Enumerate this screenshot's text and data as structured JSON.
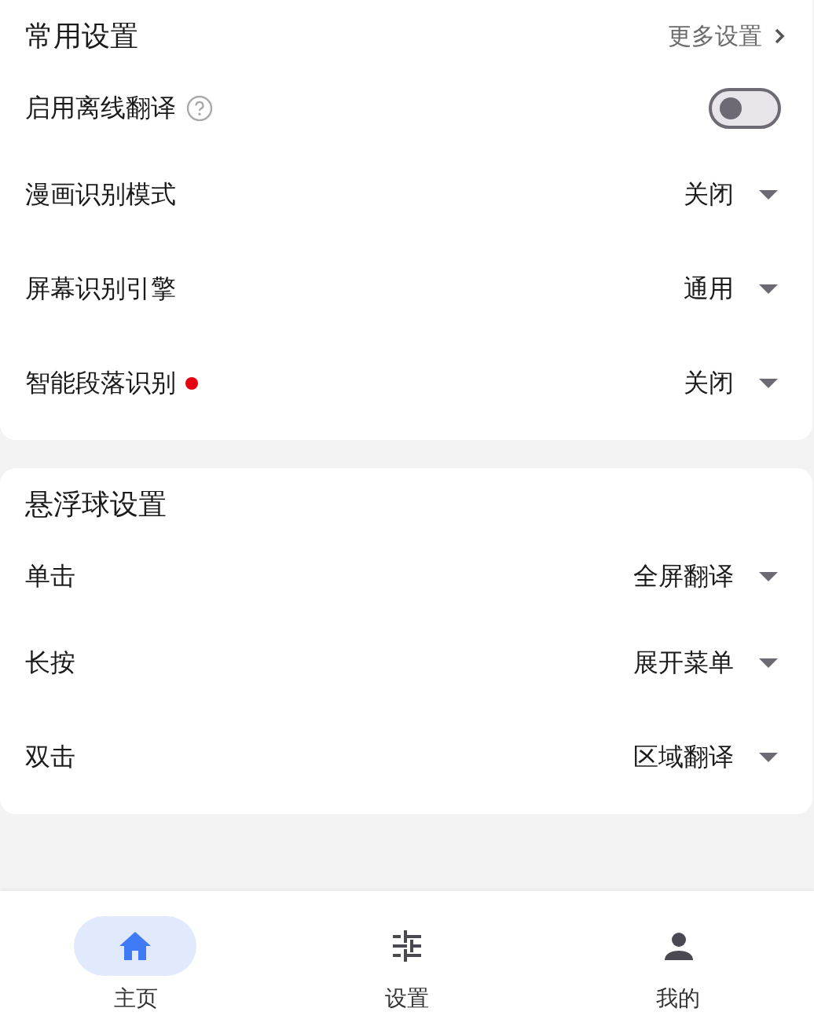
{
  "sections": [
    {
      "title": "常用设置",
      "link": "更多设置",
      "items": [
        {
          "kind": "toggle",
          "label": "启用离线翻译",
          "help": true,
          "dot": false,
          "on": false
        },
        {
          "kind": "dropdown",
          "label": "漫画识别模式",
          "help": false,
          "dot": false,
          "value": "关闭"
        },
        {
          "kind": "dropdown",
          "label": "屏幕识别引擎",
          "help": false,
          "dot": false,
          "value": "通用"
        },
        {
          "kind": "dropdown",
          "label": "智能段落识别",
          "help": false,
          "dot": true,
          "value": "关闭"
        }
      ]
    },
    {
      "title": "悬浮球设置",
      "items": [
        {
          "kind": "dropdown",
          "label": "单击",
          "help": false,
          "dot": false,
          "value": "全屏翻译"
        },
        {
          "kind": "dropdown",
          "label": "长按",
          "help": false,
          "dot": false,
          "value": "展开菜单"
        },
        {
          "kind": "dropdown",
          "label": "双击",
          "help": false,
          "dot": false,
          "value": "区域翻译"
        }
      ]
    }
  ],
  "nav": [
    {
      "kind": "home",
      "label": "主页",
      "selected": true
    },
    {
      "kind": "sliders",
      "label": "设置",
      "selected": false
    },
    {
      "kind": "person",
      "label": "我的",
      "selected": false
    }
  ]
}
